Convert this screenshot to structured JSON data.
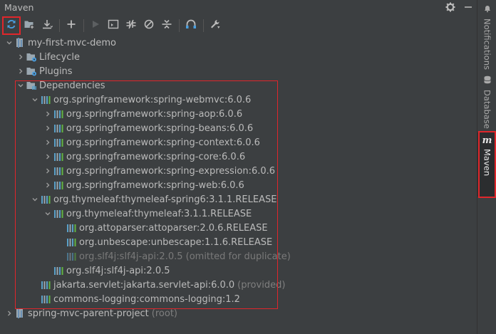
{
  "panel": {
    "title": "Maven"
  },
  "toolbar": {
    "buttons": [
      {
        "name": "reload-all-maven-projects",
        "icon": "refresh-icon"
      },
      {
        "name": "add-maven-project",
        "icon": "folder-add-icon"
      },
      {
        "name": "download-sources",
        "icon": "download-icon"
      },
      {
        "name": "add",
        "icon": "plus-icon"
      },
      {
        "name": "run-maven-build",
        "icon": "run-icon"
      },
      {
        "name": "execute-maven-goal",
        "icon": "terminal-icon"
      },
      {
        "name": "toggle-offline-mode",
        "icon": "offline-icon"
      },
      {
        "name": "skip-tests",
        "icon": "skip-tests-icon"
      },
      {
        "name": "collapse-all",
        "icon": "collapse-icon"
      },
      {
        "name": "show-dependencies",
        "icon": "dependencies-icon"
      },
      {
        "name": "maven-settings",
        "icon": "wrench-icon"
      }
    ]
  },
  "tree": {
    "project": "my-first-mvc-demo",
    "lifecycle": "Lifecycle",
    "plugins": "Plugins",
    "dependencies": "Dependencies",
    "dep_webmvc": "org.springframework:spring-webmvc:6.0.6",
    "dep_aop": "org.springframework:spring-aop:6.0.6",
    "dep_beans": "org.springframework:spring-beans:6.0.6",
    "dep_context": "org.springframework:spring-context:6.0.6",
    "dep_core": "org.springframework:spring-core:6.0.6",
    "dep_expression": "org.springframework:spring-expression:6.0.6",
    "dep_web": "org.springframework:spring-web:6.0.6",
    "dep_th_spring6": "org.thymeleaf:thymeleaf-spring6:3.1.1.RELEASE",
    "dep_thymeleaf": "org.thymeleaf:thymeleaf:3.1.1.RELEASE",
    "dep_attoparser": "org.attoparser:attoparser:2.0.6.RELEASE",
    "dep_unbescape": "org.unbescape:unbescape:1.1.6.RELEASE",
    "dep_slf4j_omitted": "org.slf4j:slf4j-api:2.0.5 (omitted for duplicate)",
    "dep_slf4j": "org.slf4j:slf4j-api:2.0.5",
    "dep_servlet": "jakarta.servlet:jakarta.servlet-api:6.0.0",
    "dep_servlet_scope": "(provided)",
    "dep_logging": "commons-logging:commons-logging:1.2",
    "parent_project": "spring-mvc-parent-project",
    "parent_suffix": "(root)"
  },
  "side_tabs": {
    "notifications": "Notifications",
    "database": "Database",
    "maven": "Maven"
  },
  "colors": {
    "background": "#3c3f41",
    "text": "#bbbbbb",
    "dim_text": "#7a7a7a",
    "highlight_border": "#e0262b",
    "refresh_icon": "#4a9fe0",
    "bars_icon": "#5aa0c8"
  }
}
